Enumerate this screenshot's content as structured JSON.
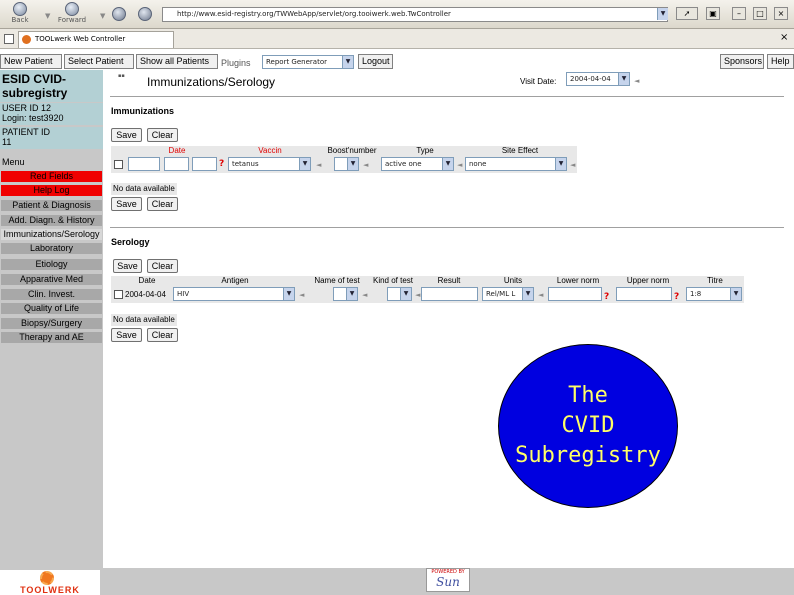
{
  "browser": {
    "back_label": "Back",
    "forward_label": "Forward",
    "url": "http://www.esid-registry.org/TWWebApp/servlet/org.tooiwerk.web.TwController",
    "tab_title": "TOOLwerk Web Controller"
  },
  "menubar": {
    "new_patient": "New Patient",
    "select_patient": "Select Patient",
    "show_all_patients": "Show all Patients",
    "plugins_label": "Plugins",
    "plugins_selected": "Report Generator",
    "logout": "Logout",
    "sponsors": "Sponsors",
    "help": "Help"
  },
  "sidebar": {
    "registry_title": "ESID CVID-subregistry",
    "user_id": "USER ID 12",
    "login": "Login: test3920",
    "patient_id_label": "PATIENT ID",
    "patient_id_value": "11",
    "menu_label": "Menu",
    "items": [
      {
        "label": "Red Fields",
        "color": "#f00000"
      },
      {
        "label": "Help Log",
        "color": "#f00000"
      },
      {
        "label": "Patient & Diagnosis"
      },
      {
        "label": "Add. Diagn. & History"
      },
      {
        "label": "Immunizations/Serology"
      },
      {
        "label": "Laboratory"
      },
      {
        "label": "Etiology"
      },
      {
        "label": "Apparative Med"
      },
      {
        "label": "Clin. Invest."
      },
      {
        "label": "Quality of Life"
      },
      {
        "label": "Biopsy/Surgery"
      },
      {
        "label": "Therapy and AE"
      }
    ]
  },
  "main": {
    "title": "Immunizations/Serology",
    "visit_date_label": "Visit Date:",
    "visit_date_value": "2004-04-04",
    "immunizations": {
      "section_title": "Immunizations",
      "save": "Save",
      "clear": "Clear",
      "headers": [
        "Date",
        "Vaccin",
        "Boost'number",
        "Type",
        "Site Effect"
      ],
      "row": {
        "vaccin": "tetanus",
        "type": "active one",
        "site_effect": "none"
      },
      "no_data": "No data available"
    },
    "serology": {
      "section_title": "Serology",
      "save": "Save",
      "clear": "Clear",
      "headers": [
        "Date",
        "Antigen",
        "Name of test",
        "Kind of test",
        "Result",
        "Units",
        "Lower norm",
        "Upper norm",
        "Titre"
      ],
      "row": {
        "date": "2004-04-04",
        "antigen": "HIV",
        "units": "Rel/ML L",
        "titre": "1:8"
      },
      "no_data": "No data available"
    }
  },
  "logo": {
    "text": "The\nCVID\nSubregistry",
    "bg": "#0000e0",
    "fg": "#ffff66"
  },
  "footer": {
    "toolwerk": "TOOLWERK",
    "sun_top": "POWERED BY",
    "sun": "Sun"
  }
}
